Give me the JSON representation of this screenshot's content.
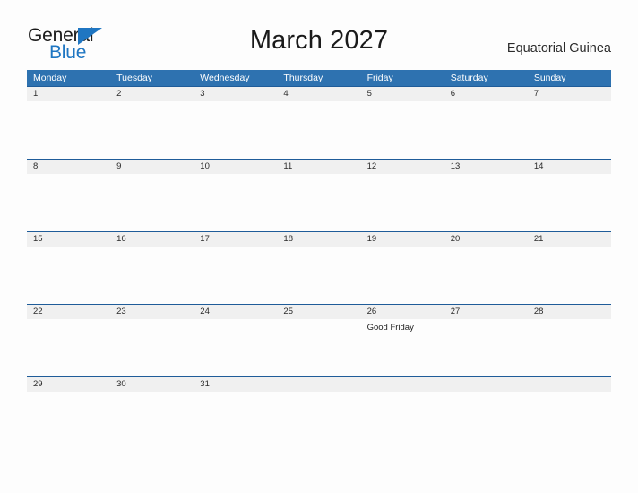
{
  "brand": {
    "name_part1": "General",
    "name_part2": "Blue",
    "triangle_icon": "brand-triangle-icon",
    "primary_color": "#1f76c2"
  },
  "header": {
    "title": "March 2027",
    "region": "Equatorial Guinea"
  },
  "calendar": {
    "month": "March",
    "year": "2027",
    "header_bg": "#2e72b0",
    "row_divider_color": "#1f5c99",
    "date_band_bg": "#f0f0f0",
    "weekdays": [
      "Monday",
      "Tuesday",
      "Wednesday",
      "Thursday",
      "Friday",
      "Saturday",
      "Sunday"
    ],
    "weeks": [
      {
        "days": [
          {
            "date": "1",
            "events": []
          },
          {
            "date": "2",
            "events": []
          },
          {
            "date": "3",
            "events": []
          },
          {
            "date": "4",
            "events": []
          },
          {
            "date": "5",
            "events": []
          },
          {
            "date": "6",
            "events": []
          },
          {
            "date": "7",
            "events": []
          }
        ]
      },
      {
        "days": [
          {
            "date": "8",
            "events": []
          },
          {
            "date": "9",
            "events": []
          },
          {
            "date": "10",
            "events": []
          },
          {
            "date": "11",
            "events": []
          },
          {
            "date": "12",
            "events": []
          },
          {
            "date": "13",
            "events": []
          },
          {
            "date": "14",
            "events": []
          }
        ]
      },
      {
        "days": [
          {
            "date": "15",
            "events": []
          },
          {
            "date": "16",
            "events": []
          },
          {
            "date": "17",
            "events": []
          },
          {
            "date": "18",
            "events": []
          },
          {
            "date": "19",
            "events": []
          },
          {
            "date": "20",
            "events": []
          },
          {
            "date": "21",
            "events": []
          }
        ]
      },
      {
        "days": [
          {
            "date": "22",
            "events": []
          },
          {
            "date": "23",
            "events": []
          },
          {
            "date": "24",
            "events": []
          },
          {
            "date": "25",
            "events": []
          },
          {
            "date": "26",
            "events": [
              "Good Friday"
            ]
          },
          {
            "date": "27",
            "events": []
          },
          {
            "date": "28",
            "events": []
          }
        ]
      },
      {
        "days": [
          {
            "date": "29",
            "events": []
          },
          {
            "date": "30",
            "events": []
          },
          {
            "date": "31",
            "events": []
          },
          {
            "date": "",
            "events": []
          },
          {
            "date": "",
            "events": []
          },
          {
            "date": "",
            "events": []
          },
          {
            "date": "",
            "events": []
          }
        ]
      }
    ]
  }
}
